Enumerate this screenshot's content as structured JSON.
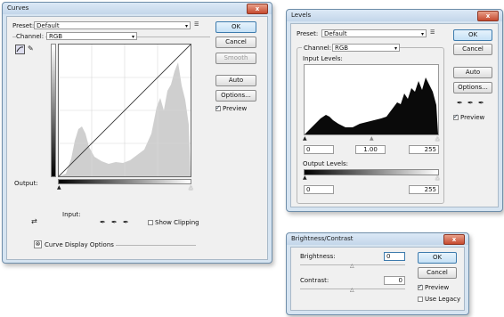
{
  "curves": {
    "title": "Curves",
    "preset_label": "Preset:",
    "preset_value": "Default",
    "preset_menu_icon": "preset-menu-icon",
    "channel_label": "Channel:",
    "channel_value": "RGB",
    "output_label": "Output:",
    "input_label": "Input:",
    "show_clipping_label": "Show Clipping",
    "show_clipping_checked": false,
    "curve_display_label": "Curve Display Options",
    "buttons": {
      "ok": "OK",
      "cancel": "Cancel",
      "smooth": "Smooth",
      "auto": "Auto",
      "options": "Options..."
    },
    "preview_label": "Preview",
    "preview_checked": true
  },
  "levels": {
    "title": "Levels",
    "preset_label": "Preset:",
    "preset_value": "Default",
    "channel_label": "Channel:",
    "channel_value": "RGB",
    "input_levels_label": "Input Levels:",
    "input_values": [
      "0",
      "1.00",
      "255"
    ],
    "output_levels_label": "Output Levels:",
    "output_values": [
      "0",
      "255"
    ],
    "buttons": {
      "ok": "OK",
      "cancel": "Cancel",
      "auto": "Auto",
      "options": "Options..."
    },
    "preview_label": "Preview",
    "preview_checked": true
  },
  "brightness": {
    "title": "Brightness/Contrast",
    "brightness_label": "Brightness:",
    "brightness_value": "0",
    "contrast_label": "Contrast:",
    "contrast_value": "0",
    "buttons": {
      "ok": "OK",
      "cancel": "Cancel"
    },
    "preview_label": "Preview",
    "preview_checked": true,
    "use_legacy_label": "Use Legacy",
    "use_legacy_checked": false
  },
  "close_glyph": "x",
  "colors": {
    "accent": "#3d7bad",
    "close": "#c64a2f",
    "window": "#d6e4f1"
  }
}
